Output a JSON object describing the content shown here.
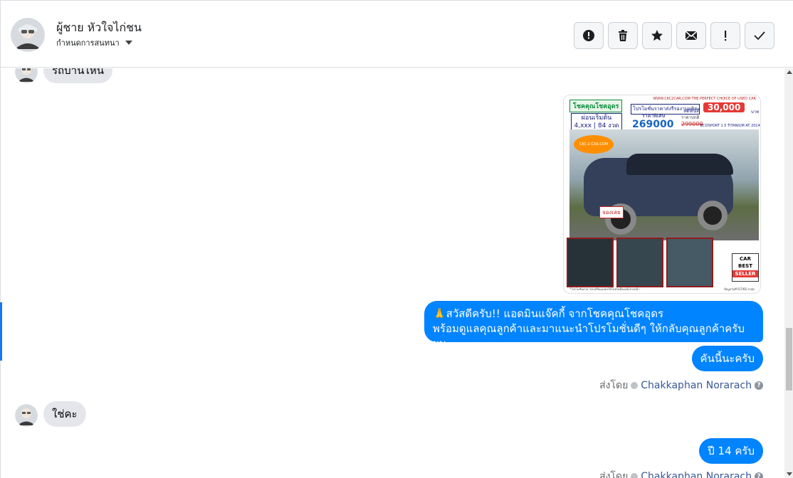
{
  "header": {
    "contact_name": "ผู้ชาย หัวใจไก่ชน",
    "assign_label": "กำหนดการสนทนา"
  },
  "actions": [
    {
      "name": "report-spam",
      "icon": "alert-circle-icon"
    },
    {
      "name": "delete",
      "icon": "trash-icon"
    },
    {
      "name": "star",
      "icon": "star-icon"
    },
    {
      "name": "mark-unread",
      "icon": "envelope-icon"
    },
    {
      "name": "follow-up",
      "icon": "exclamation-icon"
    },
    {
      "name": "mark-done",
      "icon": "check-icon"
    }
  ],
  "messages": {
    "m1_in": "รถบ้านไหน",
    "m2_ad": {
      "top_line": "WWW.CKC2CAR.COM THE PERFECT CHOICE OF USED CAR",
      "brand": "โชคคุณโชคอุดร",
      "promo": "โปรโมชั่นราคาส่งรีรองานผลิต",
      "discount_label": "ลดทันที",
      "discount": "30,000",
      "discount_unit": "บาท",
      "km_label": "ผ่อนเริ่มต้น",
      "km_value": "4,xxx | 84 งวด",
      "price_label": "ราคาพิเศษ",
      "price": "269000",
      "old_price_label": "ราคาปกติ",
      "old_price": "299000",
      "model": "ECOSPORT 1.5 TITANIUM AT 2014",
      "logo_text": "CKC-2-CAR.COM",
      "plate": "จองเลย",
      "badge_car": "CAR",
      "badge_best": "BEST",
      "badge_seller": "SELLER",
      "footer_left": "*โปรโมชั่นสามารถเปลี่ยนแปลงได้โดยไม่ต้องแจ้งล่วงหน้า",
      "footer_right": "ข้อมูลวันที่ 6/7/66 ล่าสุด"
    },
    "m3_out_line1": "🙏สวัสดีครับ!! แอดมินแจ๊คกี้ จากโชคคุณโชคอุดร",
    "m3_out_line2": "พร้อมดูแลคุณลูกค้าและมาแนะนำโปรโมชั่นดีๆ ให้กลับคุณลูกค้าครับผม",
    "m4_out": "คันนี้นะครับ",
    "sent_by_1": {
      "prefix": "ส่งโดย",
      "sender": "Chakkaphan Norarach"
    },
    "m5_in": "ใช่คะ",
    "m6_out": "ปี 14 ครับ",
    "sent_by_2": {
      "prefix": "ส่งโดย",
      "sender": "Chakkaphan Norarach"
    }
  },
  "colors": {
    "outgoing_bubble": "#0084ff",
    "incoming_bubble": "#e4e6eb",
    "accent": "#1877f2"
  }
}
